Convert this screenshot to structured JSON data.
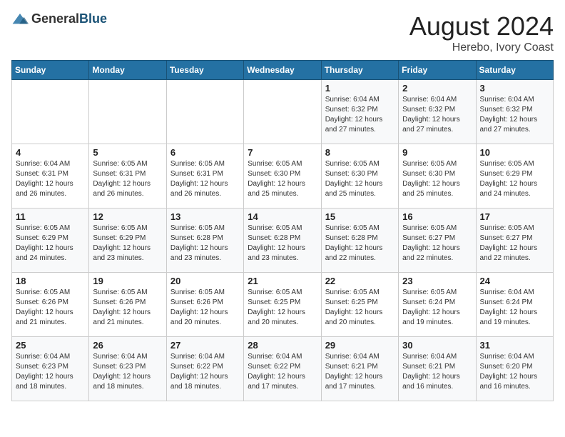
{
  "header": {
    "logo_general": "General",
    "logo_blue": "Blue",
    "month_year": "August 2024",
    "location": "Herebo, Ivory Coast"
  },
  "days_of_week": [
    "Sunday",
    "Monday",
    "Tuesday",
    "Wednesday",
    "Thursday",
    "Friday",
    "Saturday"
  ],
  "weeks": [
    [
      {
        "day": "",
        "sunrise": "",
        "sunset": "",
        "daylight": ""
      },
      {
        "day": "",
        "sunrise": "",
        "sunset": "",
        "daylight": ""
      },
      {
        "day": "",
        "sunrise": "",
        "sunset": "",
        "daylight": ""
      },
      {
        "day": "",
        "sunrise": "",
        "sunset": "",
        "daylight": ""
      },
      {
        "day": "1",
        "sunrise": "Sunrise: 6:04 AM",
        "sunset": "Sunset: 6:32 PM",
        "daylight": "Daylight: 12 hours and 27 minutes."
      },
      {
        "day": "2",
        "sunrise": "Sunrise: 6:04 AM",
        "sunset": "Sunset: 6:32 PM",
        "daylight": "Daylight: 12 hours and 27 minutes."
      },
      {
        "day": "3",
        "sunrise": "Sunrise: 6:04 AM",
        "sunset": "Sunset: 6:32 PM",
        "daylight": "Daylight: 12 hours and 27 minutes."
      }
    ],
    [
      {
        "day": "4",
        "sunrise": "Sunrise: 6:04 AM",
        "sunset": "Sunset: 6:31 PM",
        "daylight": "Daylight: 12 hours and 26 minutes."
      },
      {
        "day": "5",
        "sunrise": "Sunrise: 6:05 AM",
        "sunset": "Sunset: 6:31 PM",
        "daylight": "Daylight: 12 hours and 26 minutes."
      },
      {
        "day": "6",
        "sunrise": "Sunrise: 6:05 AM",
        "sunset": "Sunset: 6:31 PM",
        "daylight": "Daylight: 12 hours and 26 minutes."
      },
      {
        "day": "7",
        "sunrise": "Sunrise: 6:05 AM",
        "sunset": "Sunset: 6:30 PM",
        "daylight": "Daylight: 12 hours and 25 minutes."
      },
      {
        "day": "8",
        "sunrise": "Sunrise: 6:05 AM",
        "sunset": "Sunset: 6:30 PM",
        "daylight": "Daylight: 12 hours and 25 minutes."
      },
      {
        "day": "9",
        "sunrise": "Sunrise: 6:05 AM",
        "sunset": "Sunset: 6:30 PM",
        "daylight": "Daylight: 12 hours and 25 minutes."
      },
      {
        "day": "10",
        "sunrise": "Sunrise: 6:05 AM",
        "sunset": "Sunset: 6:29 PM",
        "daylight": "Daylight: 12 hours and 24 minutes."
      }
    ],
    [
      {
        "day": "11",
        "sunrise": "Sunrise: 6:05 AM",
        "sunset": "Sunset: 6:29 PM",
        "daylight": "Daylight: 12 hours and 24 minutes."
      },
      {
        "day": "12",
        "sunrise": "Sunrise: 6:05 AM",
        "sunset": "Sunset: 6:29 PM",
        "daylight": "Daylight: 12 hours and 23 minutes."
      },
      {
        "day": "13",
        "sunrise": "Sunrise: 6:05 AM",
        "sunset": "Sunset: 6:28 PM",
        "daylight": "Daylight: 12 hours and 23 minutes."
      },
      {
        "day": "14",
        "sunrise": "Sunrise: 6:05 AM",
        "sunset": "Sunset: 6:28 PM",
        "daylight": "Daylight: 12 hours and 23 minutes."
      },
      {
        "day": "15",
        "sunrise": "Sunrise: 6:05 AM",
        "sunset": "Sunset: 6:28 PM",
        "daylight": "Daylight: 12 hours and 22 minutes."
      },
      {
        "day": "16",
        "sunrise": "Sunrise: 6:05 AM",
        "sunset": "Sunset: 6:27 PM",
        "daylight": "Daylight: 12 hours and 22 minutes."
      },
      {
        "day": "17",
        "sunrise": "Sunrise: 6:05 AM",
        "sunset": "Sunset: 6:27 PM",
        "daylight": "Daylight: 12 hours and 22 minutes."
      }
    ],
    [
      {
        "day": "18",
        "sunrise": "Sunrise: 6:05 AM",
        "sunset": "Sunset: 6:26 PM",
        "daylight": "Daylight: 12 hours and 21 minutes."
      },
      {
        "day": "19",
        "sunrise": "Sunrise: 6:05 AM",
        "sunset": "Sunset: 6:26 PM",
        "daylight": "Daylight: 12 hours and 21 minutes."
      },
      {
        "day": "20",
        "sunrise": "Sunrise: 6:05 AM",
        "sunset": "Sunset: 6:26 PM",
        "daylight": "Daylight: 12 hours and 20 minutes."
      },
      {
        "day": "21",
        "sunrise": "Sunrise: 6:05 AM",
        "sunset": "Sunset: 6:25 PM",
        "daylight": "Daylight: 12 hours and 20 minutes."
      },
      {
        "day": "22",
        "sunrise": "Sunrise: 6:05 AM",
        "sunset": "Sunset: 6:25 PM",
        "daylight": "Daylight: 12 hours and 20 minutes."
      },
      {
        "day": "23",
        "sunrise": "Sunrise: 6:05 AM",
        "sunset": "Sunset: 6:24 PM",
        "daylight": "Daylight: 12 hours and 19 minutes."
      },
      {
        "day": "24",
        "sunrise": "Sunrise: 6:04 AM",
        "sunset": "Sunset: 6:24 PM",
        "daylight": "Daylight: 12 hours and 19 minutes."
      }
    ],
    [
      {
        "day": "25",
        "sunrise": "Sunrise: 6:04 AM",
        "sunset": "Sunset: 6:23 PM",
        "daylight": "Daylight: 12 hours and 18 minutes."
      },
      {
        "day": "26",
        "sunrise": "Sunrise: 6:04 AM",
        "sunset": "Sunset: 6:23 PM",
        "daylight": "Daylight: 12 hours and 18 minutes."
      },
      {
        "day": "27",
        "sunrise": "Sunrise: 6:04 AM",
        "sunset": "Sunset: 6:22 PM",
        "daylight": "Daylight: 12 hours and 18 minutes."
      },
      {
        "day": "28",
        "sunrise": "Sunrise: 6:04 AM",
        "sunset": "Sunset: 6:22 PM",
        "daylight": "Daylight: 12 hours and 17 minutes."
      },
      {
        "day": "29",
        "sunrise": "Sunrise: 6:04 AM",
        "sunset": "Sunset: 6:21 PM",
        "daylight": "Daylight: 12 hours and 17 minutes."
      },
      {
        "day": "30",
        "sunrise": "Sunrise: 6:04 AM",
        "sunset": "Sunset: 6:21 PM",
        "daylight": "Daylight: 12 hours and 16 minutes."
      },
      {
        "day": "31",
        "sunrise": "Sunrise: 6:04 AM",
        "sunset": "Sunset: 6:20 PM",
        "daylight": "Daylight: 12 hours and 16 minutes."
      }
    ]
  ]
}
